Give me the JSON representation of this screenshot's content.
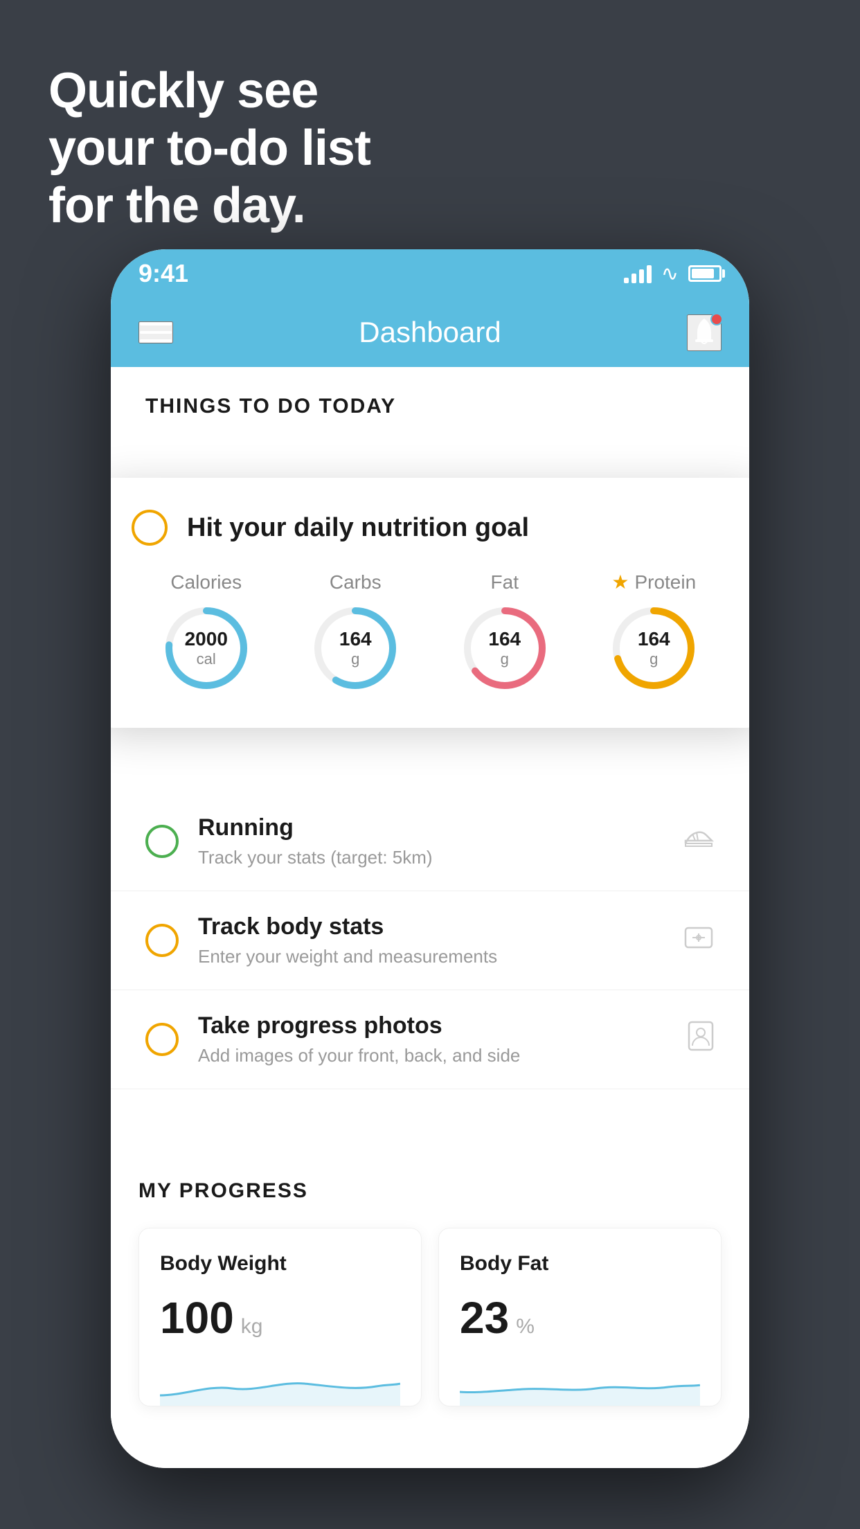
{
  "background_color": "#3a3f47",
  "headline": {
    "line1": "Quickly see",
    "line2": "your to-do list",
    "line3": "for the day."
  },
  "status_bar": {
    "time": "9:41"
  },
  "header": {
    "title": "Dashboard"
  },
  "things_section": {
    "heading": "THINGS TO DO TODAY"
  },
  "nutrition_card": {
    "title": "Hit your daily nutrition goal",
    "items": [
      {
        "label": "Calories",
        "value": "2000",
        "unit": "cal",
        "type": "blue",
        "star": false
      },
      {
        "label": "Carbs",
        "value": "164",
        "unit": "g",
        "type": "blue",
        "star": false
      },
      {
        "label": "Fat",
        "value": "164",
        "unit": "g",
        "type": "pink",
        "star": false
      },
      {
        "label": "Protein",
        "value": "164",
        "unit": "g",
        "type": "yellow",
        "star": true
      }
    ]
  },
  "todo_items": [
    {
      "name": "Running",
      "subtitle": "Track your stats (target: 5km)",
      "icon": "shoe",
      "checked": false,
      "circle_color": "green"
    },
    {
      "name": "Track body stats",
      "subtitle": "Enter your weight and measurements",
      "icon": "scale",
      "checked": false,
      "circle_color": "yellow"
    },
    {
      "name": "Take progress photos",
      "subtitle": "Add images of your front, back, and side",
      "icon": "person",
      "checked": false,
      "circle_color": "yellow"
    }
  ],
  "progress_section": {
    "heading": "MY PROGRESS",
    "cards": [
      {
        "label": "Body Weight",
        "value": "100",
        "unit": "kg"
      },
      {
        "label": "Body Fat",
        "value": "23",
        "unit": "%"
      }
    ]
  }
}
